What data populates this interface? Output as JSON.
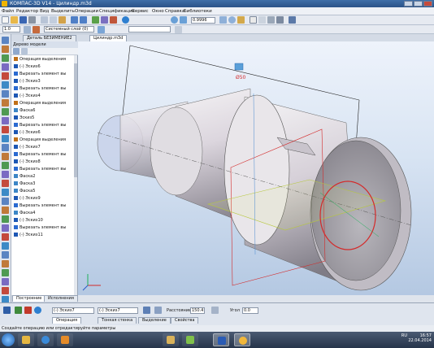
{
  "window": {
    "title": "КОМПАС-3D V14 - Цилиндр.m3d"
  },
  "menu": [
    "Файл",
    "Редактор",
    "Вид",
    "Выделить",
    "Операции",
    "Спецификация",
    "Сервис",
    "Окно",
    "Справка",
    "Библиотеки"
  ],
  "toolbar1": {
    "zoom_value": "0.9996"
  },
  "toolbar2": {
    "scale_value": "1.0",
    "style_value": "Системный слой (0)"
  },
  "document_tabs": [
    {
      "label": "Деталь БЕЗИМЕНИЕ2",
      "active": false
    },
    {
      "label": "Цилиндр.m3d",
      "active": true
    }
  ],
  "tree": {
    "header": "Дерево модели",
    "items": [
      {
        "label": "Операция выделения",
        "color": "#c07018"
      },
      {
        "label": "(-) Эскиз6",
        "color": "#1d57b4"
      },
      {
        "label": "Вырезать элемент вы",
        "color": "#2a6ad1"
      },
      {
        "label": "(-) Эскиз3",
        "color": "#1d57b4"
      },
      {
        "label": "Вырезать элемент вы",
        "color": "#2a6ad1"
      },
      {
        "label": "(-) Эскиз4",
        "color": "#1d57b4"
      },
      {
        "label": "Операция выделения",
        "color": "#c07018"
      },
      {
        "label": "Фаска6",
        "color": "#3c86c6"
      },
      {
        "label": "Эскиз5",
        "color": "#1d57b4"
      },
      {
        "label": "Вырезать элемент вы",
        "color": "#2a6ad1"
      },
      {
        "label": "(-) Эскиз6",
        "color": "#1d57b4"
      },
      {
        "label": "Операция выделения",
        "color": "#c07018"
      },
      {
        "label": "(-) Эскиз7",
        "color": "#1d57b4"
      },
      {
        "label": "Вырезать элемент вы",
        "color": "#2a6ad1"
      },
      {
        "label": "(-) Эскиз8",
        "color": "#1d57b4"
      },
      {
        "label": "Вырезать элемент вы",
        "color": "#2a6ad1"
      },
      {
        "label": "Фаска2",
        "color": "#3c86c6"
      },
      {
        "label": "Фаска3",
        "color": "#3c86c6"
      },
      {
        "label": "Фаска5",
        "color": "#3c86c6"
      },
      {
        "label": "(-) Эскиз9",
        "color": "#1d57b4"
      },
      {
        "label": "Вырезать элемент вы",
        "color": "#2a6ad1"
      },
      {
        "label": "Фаска4",
        "color": "#3c86c6"
      },
      {
        "label": "(-) Эскиз10",
        "color": "#1d57b4"
      },
      {
        "label": "Вырезать элемент вы",
        "color": "#2a6ad1"
      },
      {
        "label": "(-) Эскиз11",
        "color": "#1d57b4"
      }
    ],
    "tabs": [
      "Построение",
      "Исполнения"
    ]
  },
  "viewport": {
    "dimension_label": "Ø50",
    "dimension_color": "#d42a2a"
  },
  "bottom_panel": {
    "sketch_field_a": "(-) Эскиз7",
    "sketch_field_b": "(-) Эскиз7",
    "distance_label": "Расстояние 1",
    "distance_value": "150.4",
    "angle_label": "Угол",
    "angle_value": "0.0",
    "tabs": [
      "Операция",
      "Тонкая стенка",
      "Выделение",
      "Свойства"
    ]
  },
  "status": {
    "text": "Создайте операцию или отредактируйте параметры"
  },
  "taskbar": {
    "apps": [
      "explorer",
      "ie",
      "word",
      "kompas"
    ],
    "lang": "RU",
    "time": "16:57",
    "date": "22.04.2014"
  },
  "colors": {
    "accent": "#2a5288",
    "highlight": "#d42a2a",
    "sketch": "#1fb05a"
  }
}
